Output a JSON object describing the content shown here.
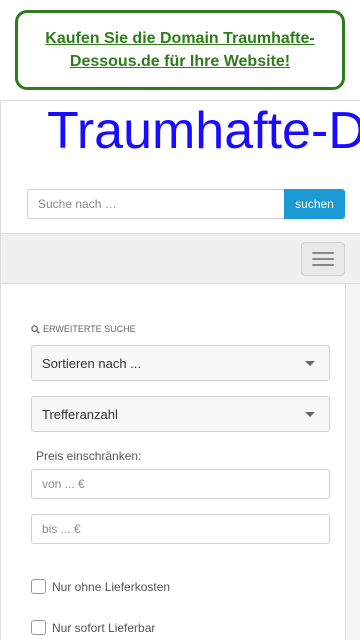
{
  "promo": {
    "link_text": "Kaufen Sie die Domain Traumhafte-Dessous.de für Ihre Website!"
  },
  "header": {
    "site_title": "Traumhafte-Dessous",
    "search_placeholder": "Suche nach …",
    "search_button": "suchen"
  },
  "sidebar": {
    "advanced_search_label": "ERWEITERTE SUCHE",
    "sort_select": "Sortieren nach ...",
    "results_select": "Trefferanzahl",
    "price_label": "Preis einschränken:",
    "price_from_placeholder": "von ... €",
    "price_to_placeholder": "bis ... €",
    "checkbox_no_shipping": "Nur ohne Lieferkosten",
    "checkbox_immediately": "Nur sofort Lieferbar"
  },
  "icons": [
    "search-icon",
    "menu-icon",
    "chevron-down-icon"
  ]
}
